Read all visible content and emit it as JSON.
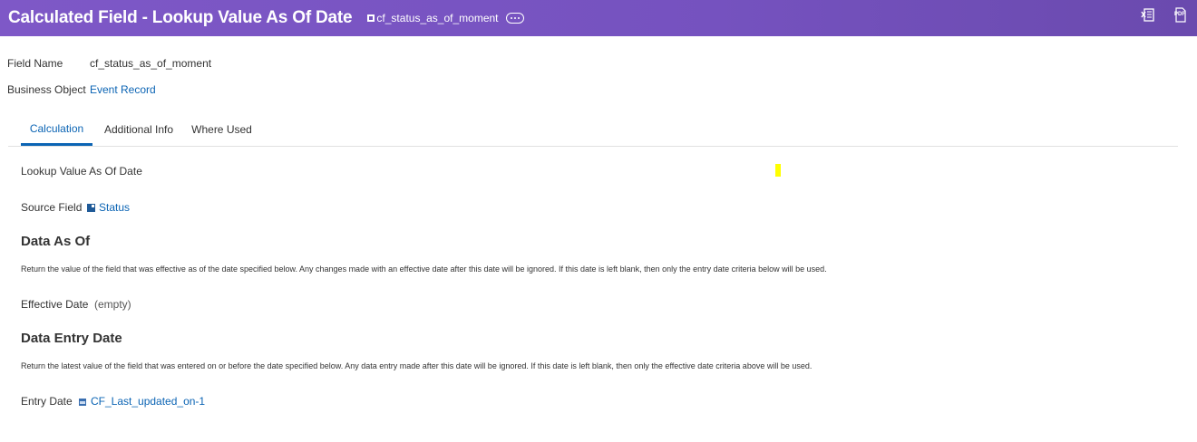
{
  "header": {
    "title": "Calculated Field - Lookup Value As Of Date",
    "instance_name": "cf_status_as_of_moment",
    "icons": [
      "instance-icon",
      "related-actions-icon",
      "excel-export-icon",
      "pdf-export-icon"
    ],
    "pdf_icon_text": "PDF",
    "background_color": "#7552bf"
  },
  "fields": {
    "field_name_label": "Field Name",
    "field_name_value": "cf_status_as_of_moment",
    "business_object_label": "Business Object",
    "business_object_value": "Event Record"
  },
  "tabs": [
    {
      "label": "Calculation",
      "active": true
    },
    {
      "label": "Additional Info",
      "active": false
    },
    {
      "label": "Where Used",
      "active": false
    }
  ],
  "calculation": {
    "function_name": "Lookup Value As Of Date",
    "source_field_label": "Source Field",
    "source_field_value": "Status",
    "data_as_of_heading": "Data As Of",
    "data_as_of_desc": "Return the value of the field that was effective as of the date specified below.  Any changes made with an effective date after this date will be ignored.  If this date is left blank, then only the entry date criteria below will be used.",
    "effective_date_label": "Effective Date",
    "effective_date_value": "(empty)",
    "data_entry_heading": "Data Entry Date",
    "data_entry_desc": "Return the latest value of the field that was entered on or before the date specified below.  Any data entry made after this date will be ignored.  If this date is left blank, then only the effective date criteria above will be used.",
    "entry_date_label": "Entry Date",
    "entry_date_value": "CF_Last_updated_on-1"
  },
  "colors": {
    "link": "#0b64b4",
    "highlight_marker": "#ffff00"
  }
}
